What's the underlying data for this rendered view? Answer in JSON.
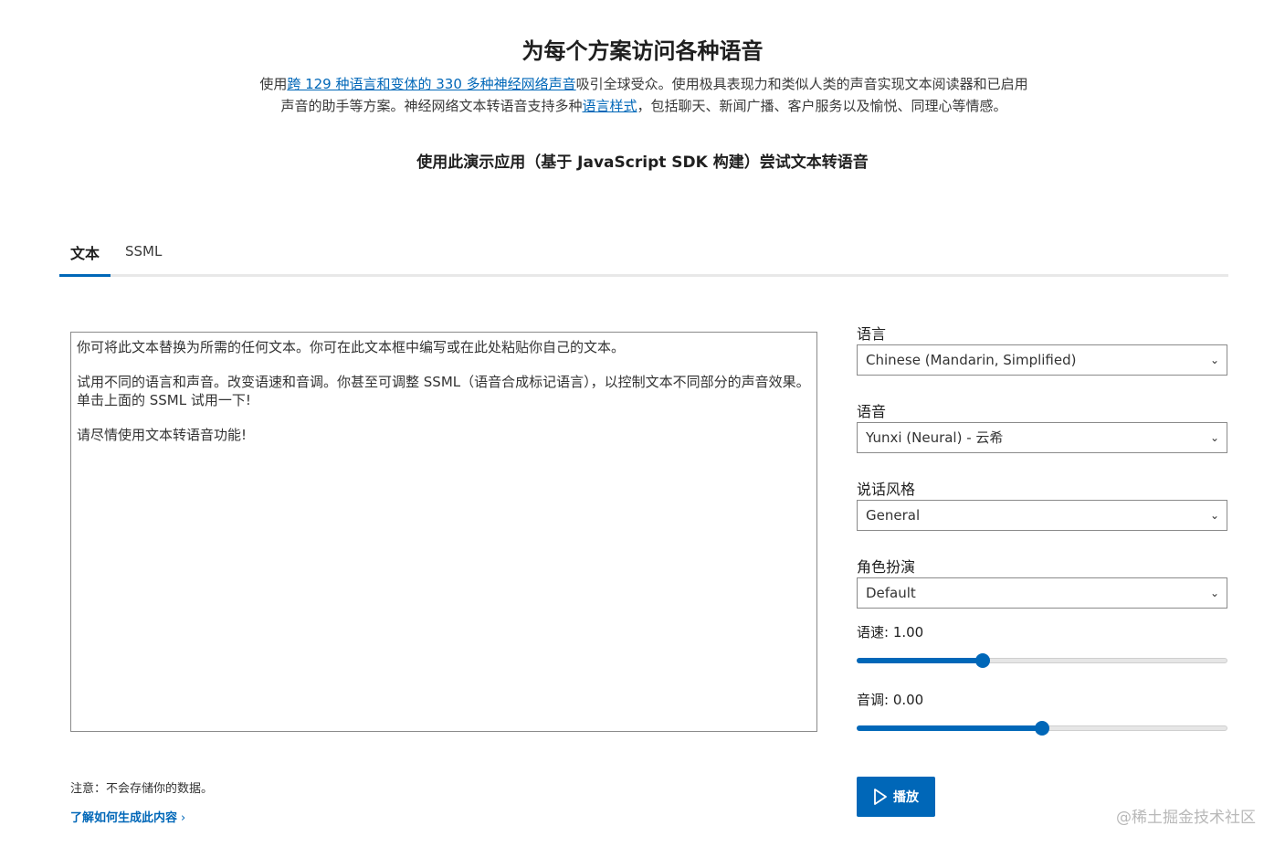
{
  "hero": {
    "title": "为每个方案访问各种语音",
    "desc_prefix": "使用",
    "desc_link1": "跨 129 种语言和变体的 330 多种神经网络声音",
    "desc_mid": "吸引全球受众。使用极具表现力和类似人类的声音实现文本阅读器和已启用声音的助手等方案。神经网络文本转语音支持多种",
    "desc_link2": "语言样式",
    "desc_suffix": "，包括聊天、新闻广播、客户服务以及愉悦、同理心等情感。",
    "subtitle": "使用此演示应用（基于 JavaScript SDK 构建）尝试文本转语音"
  },
  "tabs": [
    {
      "label": "文本",
      "active": true
    },
    {
      "label": "SSML",
      "active": false
    }
  ],
  "editor": {
    "paragraphs": [
      "你可将此文本替换为所需的任何文本。你可在此文本框中编写或在此处粘贴你自己的文本。",
      "试用不同的语言和声音。改变语速和音调。你甚至可调整 SSML（语音合成标记语言），以控制文本不同部分的声音效果。单击上面的 SSML 试用一下!",
      "请尽情使用文本转语音功能!"
    ]
  },
  "controls": {
    "language": {
      "label": "语言",
      "value": "Chinese (Mandarin, Simplified)"
    },
    "voice": {
      "label": "语音",
      "value": "Yunxi (Neural) - 云希"
    },
    "style": {
      "label": "说话风格",
      "value": "General"
    },
    "role": {
      "label": "角色扮演",
      "value": "Default"
    },
    "rate": {
      "label": "语速: 1.00",
      "fraction": 0.34
    },
    "pitch": {
      "label": "音调: 0.00",
      "fraction": 0.5
    }
  },
  "note": "注意：不会存储你的数据。",
  "learn_more": "了解如何生成此内容",
  "play_label": "播放",
  "watermark": "@稀土掘金技术社区",
  "colors": {
    "accent": "#0067b8"
  }
}
